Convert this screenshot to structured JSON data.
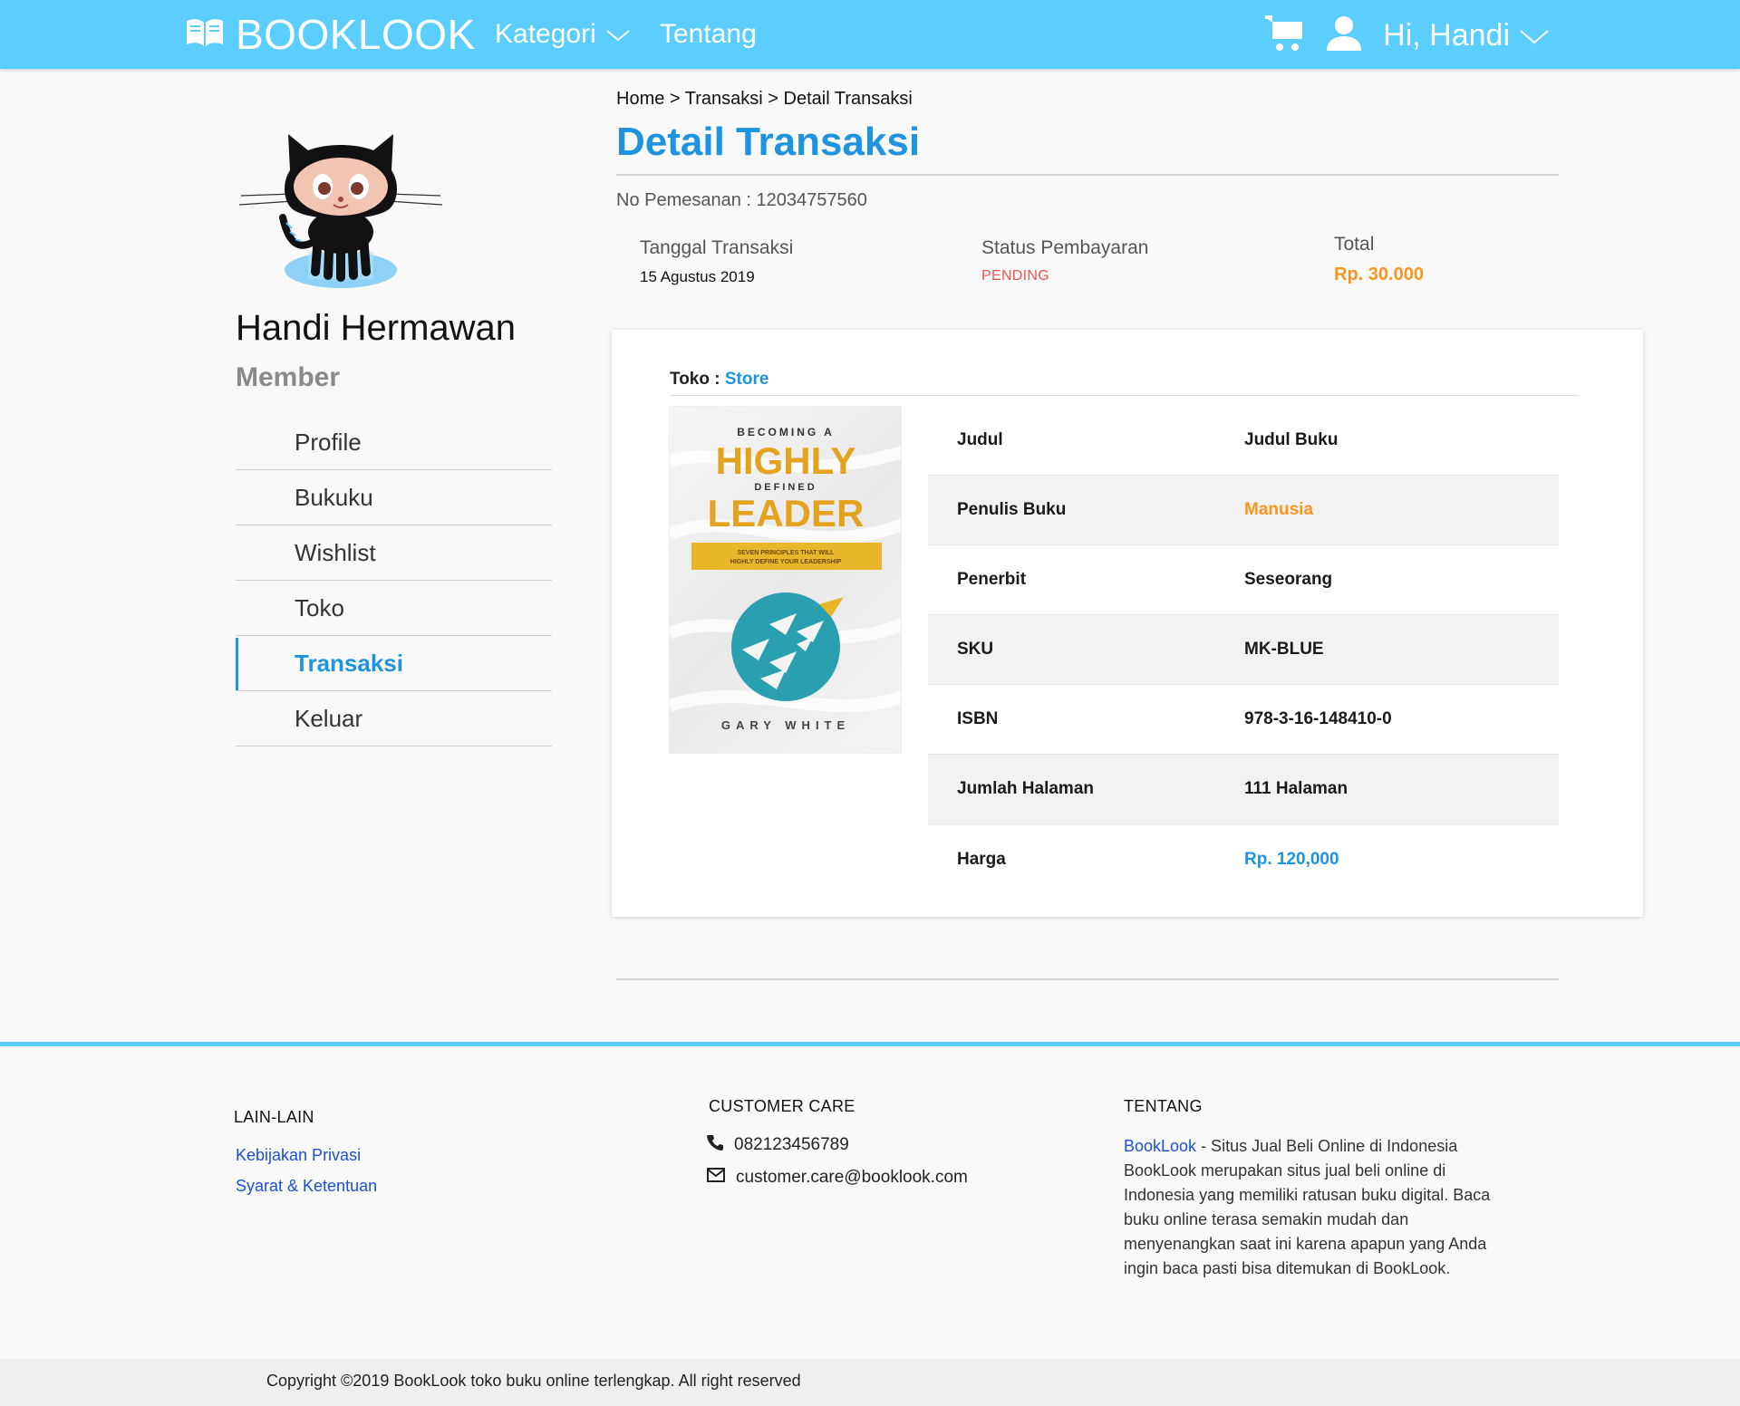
{
  "navbar": {
    "brand": "BOOKLOOK",
    "kategori": "Kategori",
    "tentang": "Tentang",
    "greeting": "Hi, Handi",
    "color": "#5bcefd"
  },
  "sidebar": {
    "name": "Handi Hermawan",
    "role": "Member",
    "items": [
      {
        "label": "Profile"
      },
      {
        "label": "Bukuku"
      },
      {
        "label": "Wishlist"
      },
      {
        "label": "Toko"
      },
      {
        "label": "Transaksi"
      },
      {
        "label": "Keluar"
      }
    ]
  },
  "main": {
    "breadcrumb": "Home > Transaksi > Detail Transaksi",
    "title": "Detail Transaksi",
    "order_no": "No Pemesanan : 12034757560",
    "tanggal_label": "Tanggal Transaksi",
    "tanggal_value": "15 Agustus 2019",
    "status_label": "Status Pembayaran",
    "status_value": "PENDING",
    "total_label": "Total",
    "total_value": "Rp. 30.000"
  },
  "card": {
    "store_label": "Toko :",
    "store_name": "Store",
    "cover": {
      "line1": "BECOMING A",
      "line2": "HIGHLY",
      "line3": "DEFINED",
      "line4": "LEADER",
      "tagline1": "SEVEN PRINCIPLES THAT WILL",
      "tagline2": "HIGHLY DEFINE YOUR LEADERSHIP",
      "author": "GARY WHITE"
    },
    "rows": [
      {
        "key": "Judul",
        "value": "Judul Buku"
      },
      {
        "key": "Penulis Buku",
        "value": "Manusia"
      },
      {
        "key": "Penerbit",
        "value": "Seseorang"
      },
      {
        "key": "SKU",
        "value": "MK-BLUE"
      },
      {
        "key": "ISBN",
        "value": "978-3-16-148410-0"
      },
      {
        "key": "Jumlah Halaman",
        "value": "111 Halaman"
      },
      {
        "key": "Harga",
        "value": "Rp. 120,000"
      }
    ]
  },
  "footer": {
    "lain_head": "LAIN-LAIN",
    "kebijakan": "Kebijakan Privasi",
    "syarat": "Syarat & Ketentuan",
    "care_head": "CUSTOMER CARE",
    "phone": "082123456789",
    "email": "customer.care@booklook.com",
    "tentang_head": "TENTANG",
    "about_brand": "BookLook",
    "about_text": " - Situs Jual Beli Online di Indonesia BookLook merupakan situs jual beli online di Indonesia yang memiliki ratusan buku digital. Baca buku online terasa semakin mudah dan menyenangkan saat ini karena apapun yang Anda ingin baca pasti bisa ditemukan di BookLook.",
    "copyright": "Copyright ©2019 BookLook toko buku online terlengkap. All right reserved"
  }
}
